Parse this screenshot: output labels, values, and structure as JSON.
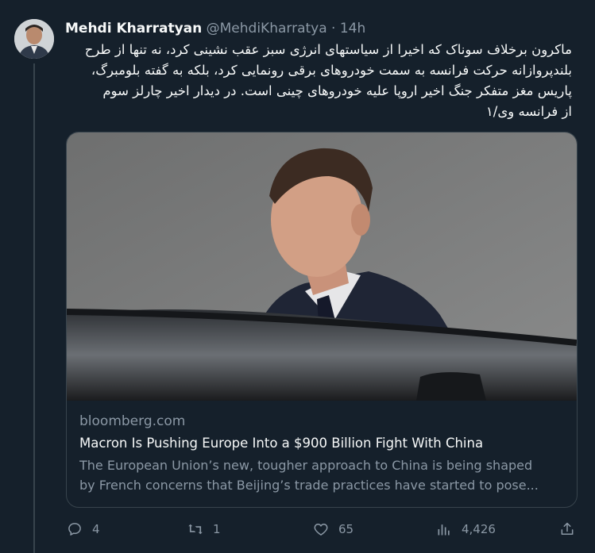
{
  "author": {
    "name": "Mehdi Kharratyan",
    "handle": "@MehdiKharratya",
    "separator": "·",
    "time": "14h"
  },
  "tweet": {
    "lines": [
      "ماکرون برخلاف سوناک که اخیرا از سیاستهای انرژی سبز عقب نشینی کرد، نه تنها از طرح",
      "بلندپروازانه حرکت فرانسه به سمت خودروهای برقی رونمایی کرد، بلکه به گفته بلومبرگ،",
      "پاریس مغز متفکر جنگ اخیر اروپا علیه خودروهای چینی است. در دیدار اخیر چارلز سوم",
      "از فرانسه وی/۱"
    ]
  },
  "card": {
    "domain": "bloomberg.com",
    "title": "Macron Is Pushing Europe Into a $900 Billion Fight With China",
    "description": [
      "The European Union’s new, tougher approach to China is being shaped",
      "by French concerns that Beijing’s trade practices have started to pose..."
    ]
  },
  "actions": {
    "replies": "4",
    "retweets": "1",
    "likes": "65",
    "views": "4,426"
  },
  "colors": {
    "background": "#15202b",
    "text": "#f7f9f9",
    "muted": "#8b98a5",
    "border": "#38444d"
  }
}
